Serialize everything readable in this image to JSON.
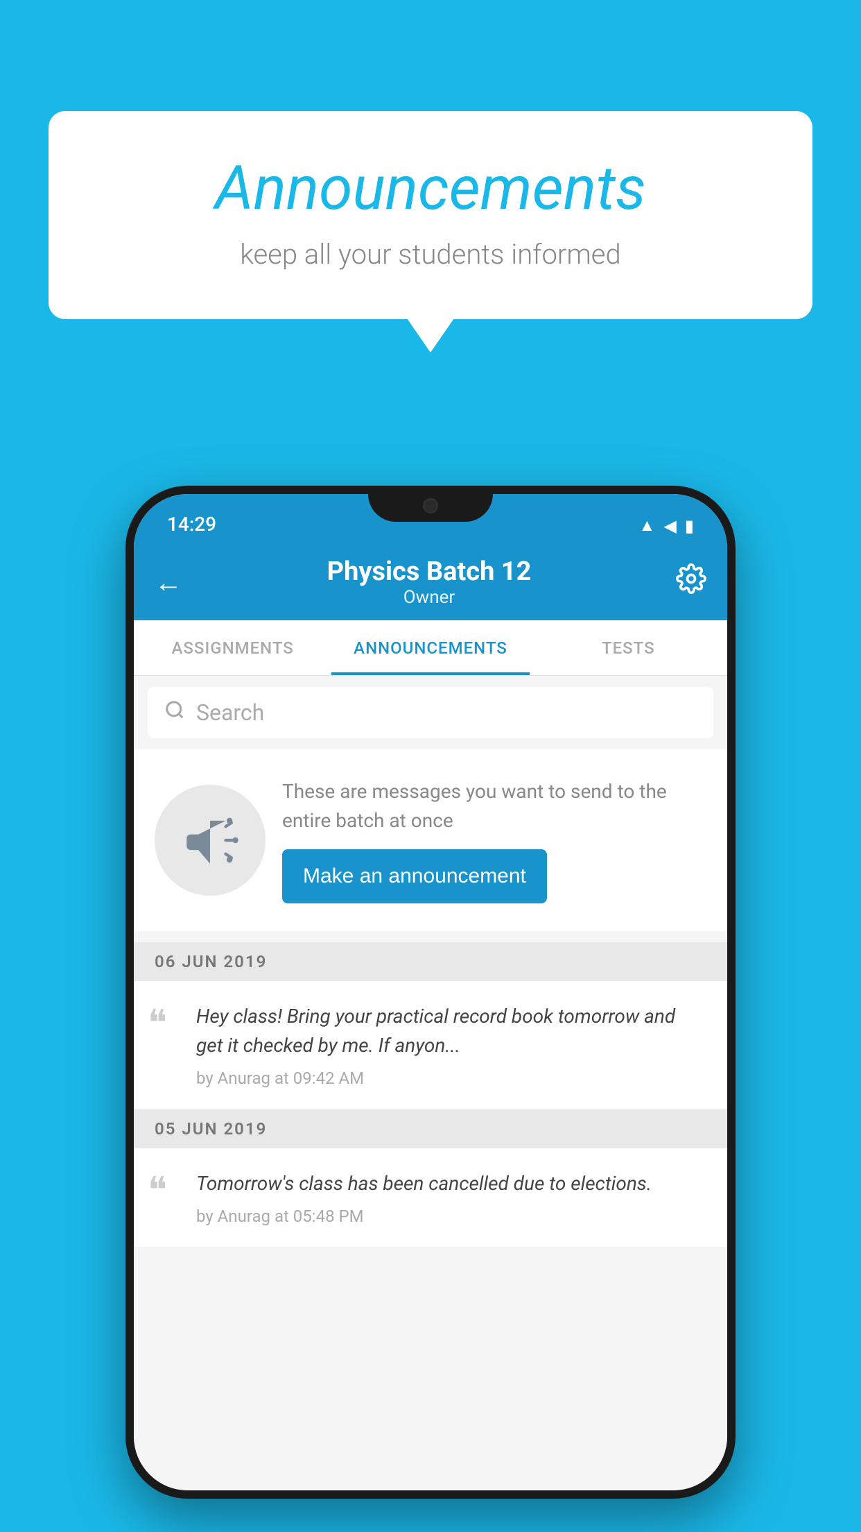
{
  "background": "#1ab8e8",
  "bubble": {
    "title": "Announcements",
    "subtitle": "keep all your students informed"
  },
  "phone": {
    "statusBar": {
      "time": "14:29"
    },
    "appBar": {
      "title": "Physics Batch 12",
      "subtitle": "Owner",
      "backLabel": "←",
      "gearLabel": "⚙"
    },
    "tabs": [
      {
        "label": "ASSIGNMENTS",
        "active": false
      },
      {
        "label": "ANNOUNCEMENTS",
        "active": true
      },
      {
        "label": "TESTS",
        "active": false
      }
    ],
    "search": {
      "placeholder": "Search"
    },
    "promptCard": {
      "text": "These are messages you want to send to the entire batch at once",
      "buttonLabel": "Make an announcement"
    },
    "announcements": [
      {
        "date": "06  JUN  2019",
        "items": [
          {
            "text": "Hey class! Bring your practical record book tomorrow and get it checked by me. If anyon...",
            "author": "by Anurag at 09:42 AM"
          }
        ]
      },
      {
        "date": "05  JUN  2019",
        "items": [
          {
            "text": "Tomorrow's class has been cancelled due to elections.",
            "author": "by Anurag at 05:48 PM"
          }
        ]
      }
    ]
  }
}
